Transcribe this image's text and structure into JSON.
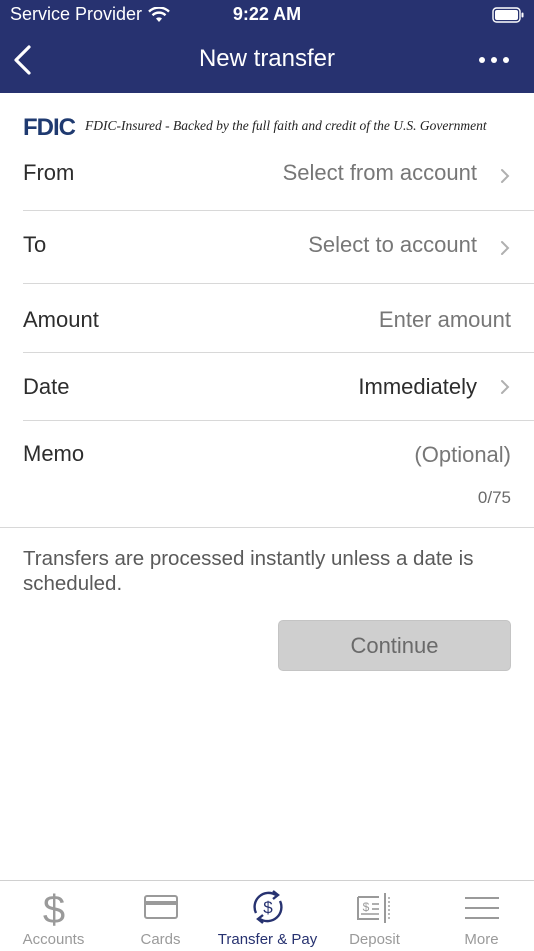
{
  "status_bar": {
    "carrier": "Service Provider",
    "time": "9:22 AM"
  },
  "nav": {
    "title": "New transfer"
  },
  "fdic": {
    "logo_text": "FDIC",
    "text": "FDIC-Insured - Backed by the full faith and credit of the U.S. Government"
  },
  "form": {
    "from": {
      "label": "From",
      "value": "Select from account"
    },
    "to": {
      "label": "To",
      "value": "Select to account"
    },
    "amount": {
      "label": "Amount",
      "placeholder": "Enter amount"
    },
    "date": {
      "label": "Date",
      "value": "Immediately"
    },
    "memo": {
      "label": "Memo",
      "placeholder": "(Optional)",
      "counter": "0/75"
    }
  },
  "note": "Transfers are processed instantly unless a date is scheduled.",
  "continue_label": "Continue",
  "tabs": [
    {
      "label": "Accounts",
      "icon": "dollar-icon"
    },
    {
      "label": "Cards",
      "icon": "card-icon"
    },
    {
      "label": "Transfer & Pay",
      "icon": "transfer-pay-icon",
      "active": true
    },
    {
      "label": "Deposit",
      "icon": "check-deposit-icon"
    },
    {
      "label": "More",
      "icon": "menu-icon"
    }
  ],
  "colors": {
    "header": "#273270",
    "accent": "#273270",
    "disabled_button": "#cfcfcf"
  }
}
